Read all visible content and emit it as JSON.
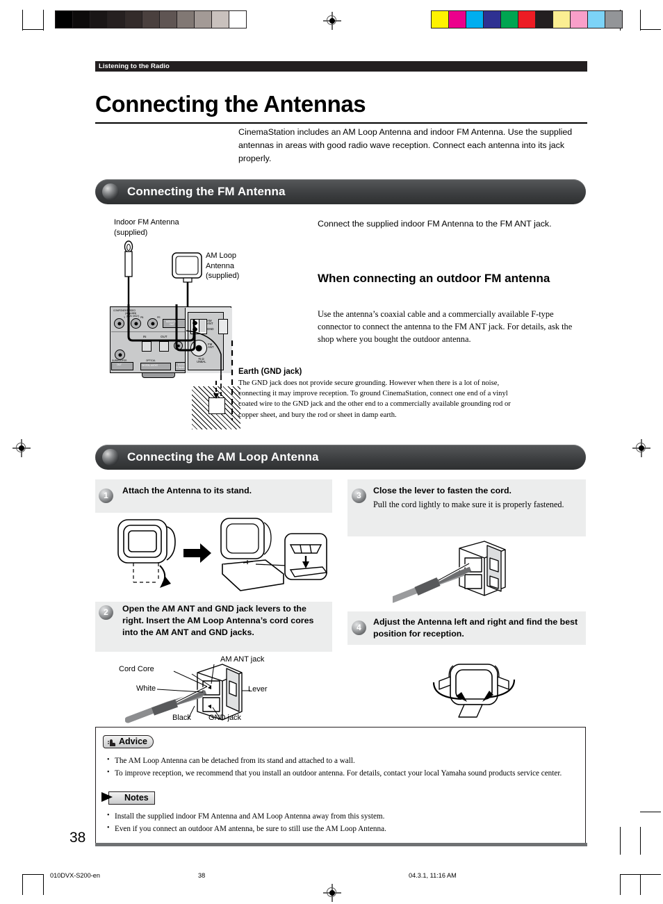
{
  "document": {
    "running_head": "Listening to the Radio",
    "title": "Connecting the Antennas",
    "intro": "CinemaStation includes an AM Loop Antenna and indoor FM Antenna. Use the supplied antennas in areas with good radio wave reception. Connect each antenna into its jack properly.",
    "page_number": "38"
  },
  "footer": {
    "file_name": "010DVX-S200-en",
    "page": "38",
    "timestamp": "04.3.1, 11:16 AM"
  },
  "fm_section": {
    "heading": "Connecting the FM Antenna",
    "intro": "Connect the supplied indoor FM Antenna to the FM ANT jack.",
    "subheading": "When connecting an outdoor FM antenna",
    "body": "Use the antenna’s coaxial cable and a commercially available F-type connector to connect the antenna to the FM ANT jack. For details, ask the shop where you bought the outdoor antenna.",
    "earth_heading": "Earth (GND jack)",
    "earth_body": "The GND jack does not provide secure grounding. However when there is a lot of noise, connecting it may improve reception. To ground CinemaStation, connect one end of a vinyl coated wire to the GND jack and the other end to a commercially available grounding rod or copper sheet, and bury the rod or sheet in damp earth.",
    "callouts": {
      "indoor_fm": "Indoor FM Antenna\n(supplied)",
      "am_loop": "AM Loop\nAntenna\n(supplied)"
    },
    "panel_labels": {
      "component_video": "COMPONENT VIDEO",
      "component_video_sub1": "(480p/480i)",
      "component_video_sub2": "(DVD ONLY)",
      "y": "Y",
      "pb": "PB",
      "pr": "PR",
      "monitor_out": "MONITOR\nOUT",
      "in": "IN",
      "out": "OUT",
      "subwoofer_out": "SUBWOOFER\nOUT",
      "optical": "OPTICAL",
      "digital_audio": "DIGITAL AUDIO",
      "system_connector": "SYSTEM\nCONNECTOR",
      "am_ant": "AM\nANT",
      "gnd": "GND",
      "fm_ant": "FM\nANT",
      "unbal": "75 Ω\nUNBAL"
    }
  },
  "am_section": {
    "heading": "Connecting the AM Loop Antenna",
    "steps": [
      {
        "number": "1",
        "title": "Attach the Antenna to its stand.",
        "body": ""
      },
      {
        "number": "2",
        "title": "Open the AM ANT and GND jack levers to the right. Insert the AM Loop Antenna’s cord cores into the AM ANT and GND jacks.",
        "body": ""
      },
      {
        "number": "3",
        "title": "Close the lever to fasten the cord.",
        "body": "Pull the cord lightly to make sure it is properly fastened."
      },
      {
        "number": "4",
        "title": "Adjust the Antenna left and right and find the best position for reception.",
        "body": ""
      }
    ],
    "callouts": {
      "cord_core": "Cord Core",
      "white": "White",
      "black": "Black",
      "am_ant_jack": "AM ANT jack",
      "gnd_jack": "GND jack",
      "lever": "Lever"
    }
  },
  "advice": {
    "label": "Advice",
    "items": [
      "The AM Loop Antenna can be detached from its stand and attached to a wall.",
      "To improve reception, we recommend that you install an outdoor antenna. For details, contact your local Yamaha sound products service center."
    ]
  },
  "notes": {
    "label": "Notes",
    "items": [
      "Install the supplied indoor FM Antenna and AM Loop Antenna away from this system.",
      "Even if you connect an outdoor AM antenna, be sure to still use the AM Loop Antenna."
    ]
  },
  "print_marks": {
    "gray_wedge": [
      "#000000",
      "#0d0b0b",
      "#1a1616",
      "#262020",
      "#332b2a",
      "#4a403e",
      "#5f5553",
      "#817874",
      "#a39a96",
      "#c9c1bd",
      "#ffffff"
    ],
    "color_bars": [
      "#fff200",
      "#ec008c",
      "#00aeef",
      "#2e3192",
      "#00a551",
      "#ed1c24",
      "#231f20",
      "#fbee92",
      "#f99fc9",
      "#7cd3f7",
      "#939598"
    ]
  }
}
